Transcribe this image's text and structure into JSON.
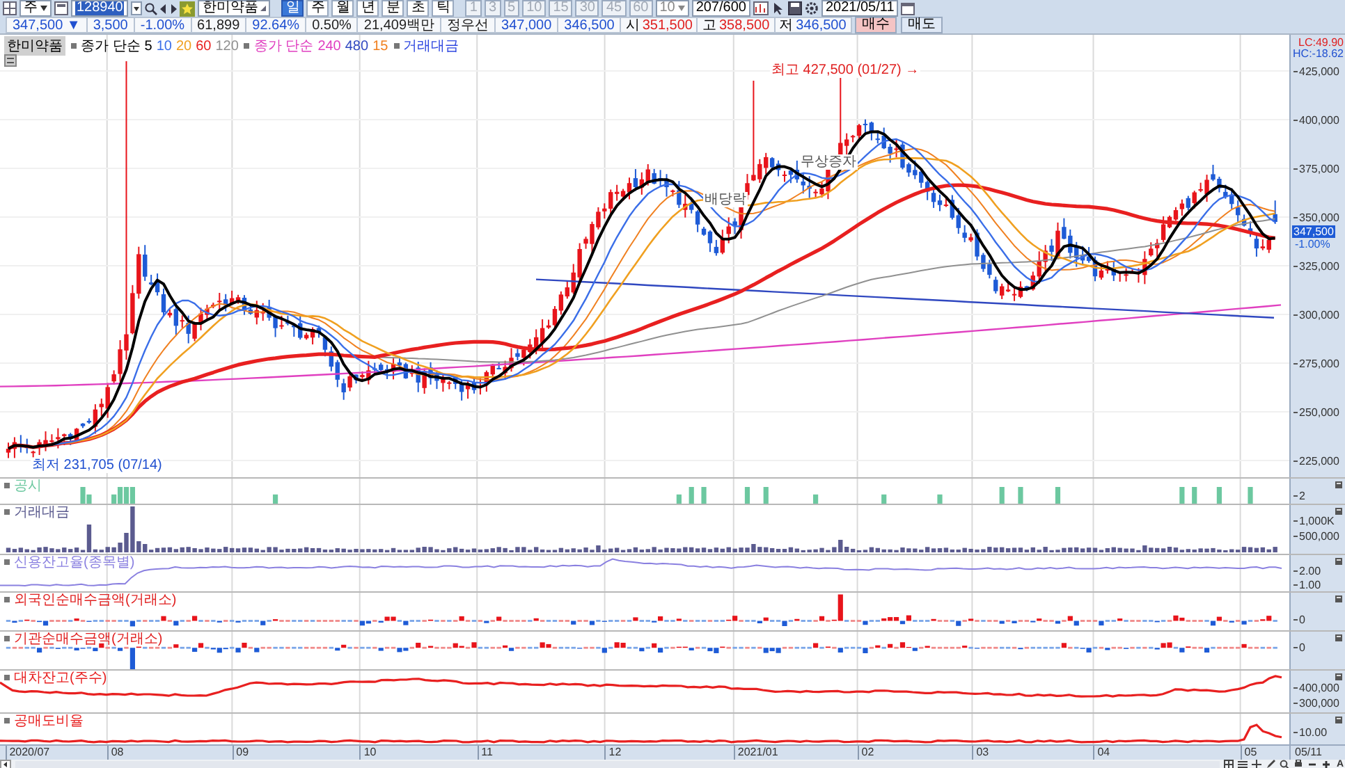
{
  "toolbar": {
    "view": "주",
    "code": "128940",
    "name": "한미약품",
    "period_buttons": [
      {
        "label": "일",
        "selected": true
      },
      {
        "label": "주",
        "selected": false
      },
      {
        "label": "월",
        "selected": false
      },
      {
        "label": "년",
        "selected": false
      },
      {
        "label": "분",
        "selected": false
      },
      {
        "label": "초",
        "selected": false
      },
      {
        "label": "틱",
        "selected": false
      }
    ],
    "minute_buttons": [
      {
        "label": "1",
        "disabled": true
      },
      {
        "label": "3",
        "disabled": true
      },
      {
        "label": "5",
        "disabled": true
      },
      {
        "label": "10",
        "disabled": true
      },
      {
        "label": "15",
        "disabled": true
      },
      {
        "label": "30",
        "disabled": true
      },
      {
        "label": "45",
        "disabled": true
      },
      {
        "label": "60",
        "disabled": true
      }
    ],
    "count": "10",
    "range": "207/600",
    "date": "2021/05/11"
  },
  "quote_bar": {
    "items": [
      {
        "text": "347,500 ▼",
        "color": "#2050d0"
      },
      {
        "text": "3,500",
        "color": "#2050d0"
      },
      {
        "text": "-1.00%",
        "color": "#2050d0"
      },
      {
        "text": "61,899",
        "color": "#222222"
      },
      {
        "text": "92.64%",
        "color": "#2050d0"
      },
      {
        "text": "0.50%",
        "color": "#222222"
      },
      {
        "text": "21,409백만",
        "color": "#222222"
      },
      {
        "text": "정우선",
        "color": "#222222"
      },
      {
        "text": "347,000",
        "color": "#2050d0"
      },
      {
        "text": "346,500",
        "color": "#2050d0"
      }
    ],
    "ohlc": [
      {
        "label": "시",
        "value": "351,500",
        "color": "#e02020"
      },
      {
        "label": "고",
        "value": "358,500",
        "color": "#e02020"
      },
      {
        "label": "저",
        "value": "346,500",
        "color": "#2050d0"
      }
    ],
    "buttons": [
      {
        "label": "매수",
        "kind": "buy"
      },
      {
        "label": "매도",
        "kind": "sell"
      }
    ]
  },
  "main_chart": {
    "series_name": "한미약품",
    "legend": [
      {
        "label": "종가 단순",
        "color": "#000000",
        "items": [
          {
            "text": "5",
            "color": "#000000"
          },
          {
            "text": "10",
            "color": "#3a6ee8"
          },
          {
            "text": "20",
            "color": "#f0a020"
          },
          {
            "text": "60",
            "color": "#e82020"
          },
          {
            "text": "120",
            "color": "#909090"
          }
        ]
      },
      {
        "label": "종가 단순",
        "color": "#e040c0",
        "items": [
          {
            "text": "240",
            "color": "#e040c0"
          },
          {
            "text": "480",
            "color": "#3048c0"
          },
          {
            "text": "15",
            "color": "#f08020"
          }
        ]
      },
      {
        "label": "거래대금",
        "color": "#3048e0"
      }
    ],
    "annotations": [
      {
        "text": "최고 427,500 (01/27) →",
        "kind": "high"
      },
      {
        "text": "최저 231,705 (07/14)",
        "kind": "low"
      },
      {
        "text": "배당락",
        "kind": "event"
      },
      {
        "text": "무상증자",
        "kind": "event"
      }
    ],
    "corner_labels": [
      {
        "text": "LC:49.90",
        "kind": "lc"
      },
      {
        "text": "HC:-18.62",
        "kind": "hc"
      }
    ],
    "axis_labels": [
      "425,000",
      "400,000",
      "375,000",
      "350,000",
      "325,000",
      "300,000",
      "275,000",
      "250,000",
      "225,000"
    ],
    "price_tag": "347,500",
    "price_tag_change": "-1.00%"
  },
  "panels": [
    {
      "title": "공시",
      "kind": "events",
      "color": "#6cc8a0",
      "axis_labels": [
        "2"
      ]
    },
    {
      "title": "거래대금",
      "kind": "volume",
      "color": "#5b5b8f",
      "axis_labels": [
        "1,000K",
        "500,000"
      ]
    },
    {
      "title": "신용잔고율(종목별)",
      "kind": "line",
      "color": "#8a80e0",
      "axis_labels": [
        "2.00",
        "1.00"
      ]
    },
    {
      "title": "외국인순매수금액(거래소)",
      "kind": "signed",
      "color": "#e02020",
      "axis_labels": [
        "0"
      ]
    },
    {
      "title": "기관순매수금액(거래소)",
      "kind": "signed",
      "color": "#e02020",
      "axis_labels": [
        "0"
      ]
    },
    {
      "title": "대차잔고(주수)",
      "kind": "line",
      "color": "#e82020",
      "axis_labels": [
        "400,000",
        "300,000"
      ]
    },
    {
      "title": "공매도비율",
      "kind": "line",
      "color": "#e82020",
      "axis_labels": [
        "10.00"
      ]
    }
  ],
  "x_axis": {
    "labels": [
      "2020/07",
      "08",
      "09",
      "10",
      "11",
      "12",
      "2021/01",
      "02",
      "03",
      "04",
      "05"
    ],
    "cursor_date": "05/11"
  },
  "bottom_tools": {
    "text_button": "A"
  }
}
